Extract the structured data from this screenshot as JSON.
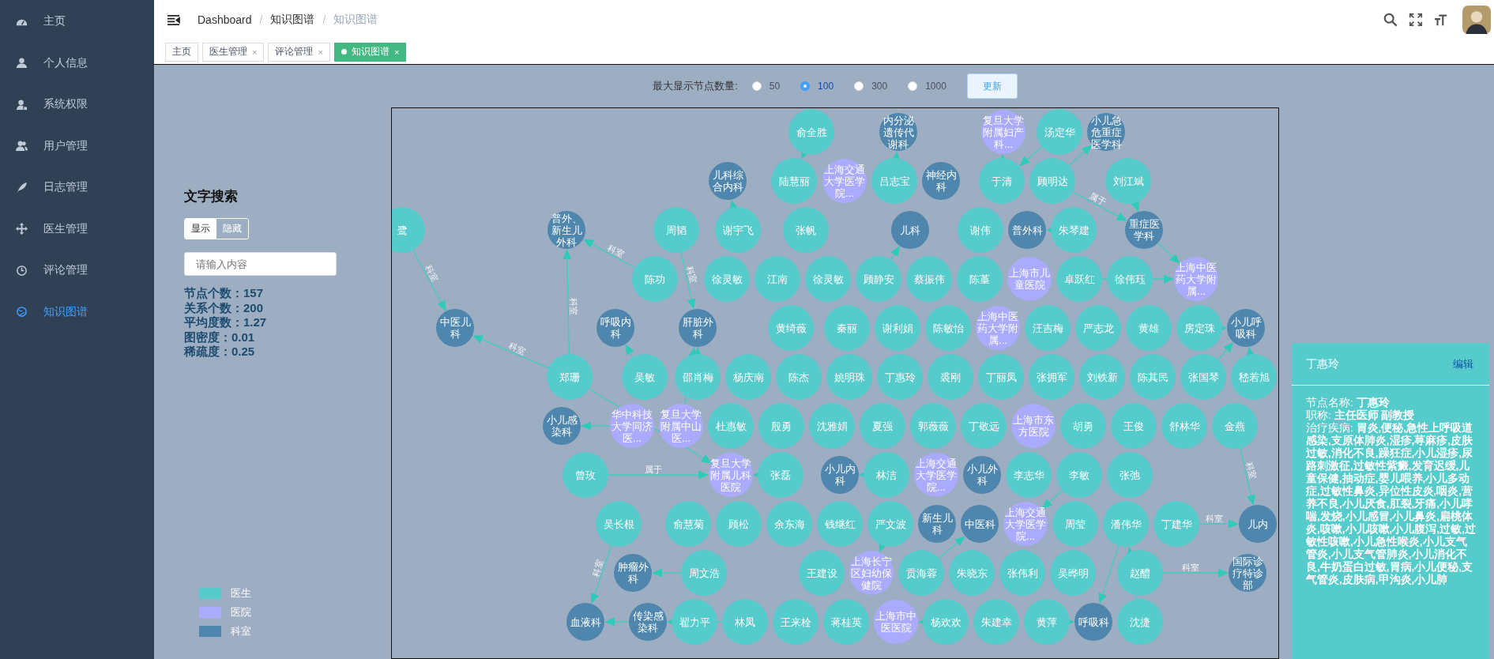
{
  "sidebar": {
    "items": [
      {
        "label": "主页",
        "selected": false
      },
      {
        "label": "个人信息",
        "selected": false
      },
      {
        "label": "系统权限",
        "selected": false
      },
      {
        "label": "用户管理",
        "selected": false
      },
      {
        "label": "日志管理",
        "selected": false
      },
      {
        "label": "医生管理",
        "selected": false
      },
      {
        "label": "评论管理",
        "selected": false
      },
      {
        "label": "知识图谱",
        "selected": true
      }
    ]
  },
  "header": {
    "breadcrumb": [
      {
        "label": "Dashboard"
      },
      {
        "label": "知识图谱",
        "separator": "/"
      },
      {
        "label": "知识图谱",
        "separator": "/"
      }
    ]
  },
  "tabs": [
    {
      "label": "主页",
      "selected": false
    },
    {
      "label": "医生管理",
      "close": "×",
      "selected": false
    },
    {
      "label": "评论管理",
      "close": "×",
      "selected": false
    },
    {
      "label": "知识图谱",
      "close": "×",
      "selected": true
    }
  ],
  "controls": {
    "label": "最大显示节点数量:",
    "options": [
      {
        "label": "50",
        "selected": false
      },
      {
        "label": "100",
        "selected": true
      },
      {
        "label": "300",
        "selected": false
      },
      {
        "label": "1000",
        "selected": false
      }
    ],
    "update_button": "更新"
  },
  "search_panel": {
    "title": "文字搜索",
    "toggle": [
      {
        "label": "显示",
        "selected": true
      },
      {
        "label": "隐藏",
        "selected": false
      }
    ],
    "search": {
      "placeholder": "请输入内容"
    },
    "stats": [
      {
        "label": "节点个数：",
        "value": "157"
      },
      {
        "label": "关系个数：",
        "value": "200"
      },
      {
        "label": "平均度数：",
        "value": "1.27"
      },
      {
        "label": "图密度：",
        "value": "0.01"
      },
      {
        "label": "稀疏度：",
        "value": "0.25"
      }
    ],
    "legend": [
      {
        "kind": "doctor",
        "label": "医生",
        "color": "#56cbcb"
      },
      {
        "kind": "hospital",
        "label": "医院",
        "color": "#aaaaff"
      },
      {
        "kind": "department",
        "label": "科室",
        "color": "#4e86ad"
      }
    ]
  },
  "graph": {
    "nodes": [
      {
        "name": "俞全胜",
        "kind": "doctor"
      },
      {
        "name": "内分泌遗传代谢科",
        "kind": "department"
      },
      {
        "name": "复旦大学附属妇产科...",
        "kind": "hospital"
      },
      {
        "name": "汤定华",
        "kind": "doctor"
      },
      {
        "name": "小儿急危重症医学科",
        "kind": "department"
      },
      {
        "name": "儿科综合内科",
        "kind": "department"
      },
      {
        "name": "陆慧丽",
        "kind": "doctor"
      },
      {
        "name": "上海交通大学医学院...",
        "kind": "hospital"
      },
      {
        "name": "吕志宝",
        "kind": "doctor"
      },
      {
        "name": "神经内科",
        "kind": "department"
      },
      {
        "name": "于清",
        "kind": "doctor"
      },
      {
        "name": "顾明达",
        "kind": "doctor"
      },
      {
        "name": "刘江斌",
        "kind": "doctor"
      },
      {
        "name": "鹭",
        "kind": "doctor"
      },
      {
        "name": "普外、新生儿外科",
        "kind": "department"
      },
      {
        "name": "周韬",
        "kind": "doctor"
      },
      {
        "name": "谢宇飞",
        "kind": "doctor"
      },
      {
        "name": "张帆",
        "kind": "doctor"
      },
      {
        "name": "儿科",
        "kind": "department"
      },
      {
        "name": "谢伟",
        "kind": "doctor"
      },
      {
        "name": "普外科",
        "kind": "department"
      },
      {
        "name": "朱琴建",
        "kind": "doctor"
      },
      {
        "name": "重症医学科",
        "kind": "department"
      },
      {
        "name": "陈功",
        "kind": "doctor"
      },
      {
        "name": "徐灵敏",
        "kind": "doctor"
      },
      {
        "name": "江南",
        "kind": "doctor"
      },
      {
        "name": "徐灵敏",
        "kind": "doctor"
      },
      {
        "name": "顾静安",
        "kind": "doctor"
      },
      {
        "name": "蔡振伟",
        "kind": "doctor"
      },
      {
        "name": "陈堇",
        "kind": "doctor"
      },
      {
        "name": "上海市儿童医院",
        "kind": "hospital"
      },
      {
        "name": "卓跃红",
        "kind": "doctor"
      },
      {
        "name": "徐伟珏",
        "kind": "doctor"
      },
      {
        "name": "上海中医药大学附属...",
        "kind": "hospital"
      },
      {
        "name": "中医儿科",
        "kind": "department"
      },
      {
        "name": "呼吸内科",
        "kind": "department"
      },
      {
        "name": "肝脏外科",
        "kind": "department"
      },
      {
        "name": "黄绮薇",
        "kind": "doctor"
      },
      {
        "name": "秦丽",
        "kind": "doctor"
      },
      {
        "name": "谢利娟",
        "kind": "doctor"
      },
      {
        "name": "陈敏怡",
        "kind": "doctor"
      },
      {
        "name": "上海中医药大学附属...",
        "kind": "hospital"
      },
      {
        "name": "汪吉梅",
        "kind": "doctor"
      },
      {
        "name": "严志龙",
        "kind": "doctor"
      },
      {
        "name": "黄雄",
        "kind": "doctor"
      },
      {
        "name": "房定珠",
        "kind": "doctor"
      },
      {
        "name": "小儿呼吸科",
        "kind": "department"
      },
      {
        "name": "郑珊",
        "kind": "doctor"
      },
      {
        "name": "吴敏",
        "kind": "doctor"
      },
      {
        "name": "邵肖梅",
        "kind": "doctor"
      },
      {
        "name": "杨庆南",
        "kind": "doctor"
      },
      {
        "name": "陈杰",
        "kind": "doctor"
      },
      {
        "name": "姚明珠",
        "kind": "doctor"
      },
      {
        "name": "丁惠玲",
        "kind": "doctor"
      },
      {
        "name": "裘刚",
        "kind": "doctor"
      },
      {
        "name": "丁丽凤",
        "kind": "doctor"
      },
      {
        "name": "张拥军",
        "kind": "doctor"
      },
      {
        "name": "刘铁新",
        "kind": "doctor"
      },
      {
        "name": "陈其民",
        "kind": "doctor"
      },
      {
        "name": "张国琴",
        "kind": "doctor"
      },
      {
        "name": "嵇若旭",
        "kind": "doctor"
      },
      {
        "name": "小儿感染科",
        "kind": "department"
      },
      {
        "name": "华中科技大学同济医...",
        "kind": "hospital"
      },
      {
        "name": "复旦大学附属中山医...",
        "kind": "hospital"
      },
      {
        "name": "杜惠敏",
        "kind": "doctor"
      },
      {
        "name": "殷勇",
        "kind": "doctor"
      },
      {
        "name": "沈雅娟",
        "kind": "doctor"
      },
      {
        "name": "夏强",
        "kind": "doctor"
      },
      {
        "name": "郭薇薇",
        "kind": "doctor"
      },
      {
        "name": "丁敬远",
        "kind": "doctor"
      },
      {
        "name": "上海市东方医院",
        "kind": "hospital"
      },
      {
        "name": "胡勇",
        "kind": "doctor"
      },
      {
        "name": "王俊",
        "kind": "doctor"
      },
      {
        "name": "舒林华",
        "kind": "doctor"
      },
      {
        "name": "金燕",
        "kind": "doctor"
      },
      {
        "name": "曾玫",
        "kind": "doctor"
      },
      {
        "name": "复旦大学附属儿科医院",
        "kind": "hospital"
      },
      {
        "name": "张磊",
        "kind": "doctor"
      },
      {
        "name": "小儿内科",
        "kind": "department"
      },
      {
        "name": "林洁",
        "kind": "doctor"
      },
      {
        "name": "上海交通大学医学院...",
        "kind": "hospital"
      },
      {
        "name": "小儿外科",
        "kind": "department"
      },
      {
        "name": "李志华",
        "kind": "doctor"
      },
      {
        "name": "李敏",
        "kind": "doctor"
      },
      {
        "name": "张弛",
        "kind": "doctor"
      },
      {
        "name": "吴长根",
        "kind": "doctor"
      },
      {
        "name": "俞慧菊",
        "kind": "doctor"
      },
      {
        "name": "顾松",
        "kind": "doctor"
      },
      {
        "name": "余东海",
        "kind": "doctor"
      },
      {
        "name": "钱继红",
        "kind": "doctor"
      },
      {
        "name": "严文波",
        "kind": "doctor"
      },
      {
        "name": "新生儿科",
        "kind": "department"
      },
      {
        "name": "中医科",
        "kind": "department"
      },
      {
        "name": "上海交通大学医学院...",
        "kind": "hospital"
      },
      {
        "name": "周莹",
        "kind": "doctor"
      },
      {
        "name": "潘伟华",
        "kind": "doctor"
      },
      {
        "name": "丁建华",
        "kind": "doctor"
      },
      {
        "name": "儿内",
        "kind": "department"
      },
      {
        "name": "肿瘤外科",
        "kind": "department"
      },
      {
        "name": "周文浩",
        "kind": "doctor"
      },
      {
        "name": "王建设",
        "kind": "doctor"
      },
      {
        "name": "上海长宁区妇幼保健院",
        "kind": "hospital"
      },
      {
        "name": "贡海蓉",
        "kind": "doctor"
      },
      {
        "name": "朱晓东",
        "kind": "doctor"
      },
      {
        "name": "张伟利",
        "kind": "doctor"
      },
      {
        "name": "吴晔明",
        "kind": "doctor"
      },
      {
        "name": "赵醴",
        "kind": "doctor"
      },
      {
        "name": "国际诊疗特诊部",
        "kind": "department"
      },
      {
        "name": "血液科",
        "kind": "department"
      },
      {
        "name": "传染感染科",
        "kind": "department"
      },
      {
        "name": "翟力平",
        "kind": "doctor"
      },
      {
        "name": "林凤",
        "kind": "doctor"
      },
      {
        "name": "王来栓",
        "kind": "doctor"
      },
      {
        "name": "蒋桂英",
        "kind": "doctor"
      },
      {
        "name": "上海市中医医院",
        "kind": "hospital"
      },
      {
        "name": "杨欢欢",
        "kind": "doctor"
      },
      {
        "name": "朱建幸",
        "kind": "doctor"
      },
      {
        "name": "黄萍",
        "kind": "doctor"
      },
      {
        "name": "呼吸科",
        "kind": "department"
      },
      {
        "name": "沈捷",
        "kind": "doctor"
      }
    ],
    "edges": [
      {
        "label": "科室"
      },
      {
        "label": "科室"
      },
      {
        "label": "科室"
      },
      {
        "label": "科室"
      },
      {
        "label": "科室"
      },
      {
        "label": "科室"
      },
      {
        "label": "科室"
      },
      {
        "label": "科室"
      },
      {
        "label": "科室"
      },
      {
        "label": "属于"
      },
      {
        "label": "属于"
      }
    ]
  },
  "detail_panel": {
    "title": "丁惠玲",
    "edit_link": "编辑",
    "fields": [
      {
        "label": "节点名称: ",
        "value": "丁惠玲"
      },
      {
        "label": "职称: ",
        "value": "主任医师  副教授"
      },
      {
        "label": "治疗疾病: ",
        "value": "胃炎,便秘,急性上呼吸道感染,支原体肺炎,湿疹,荨麻疹,皮肤过敏,消化不良,躁狂症,小儿湿疹,尿路刺激征,过敏性紫癜,发育迟缓,儿童保健,抽动症,婴儿喂养,小儿多动症,过敏性鼻炎,异位性皮炎,咽炎,营养不良,小儿厌食,肛裂,牙痛,小儿哮喘,发烧,小儿感冒,小儿鼻炎,扁桃体炎,咳嗽,小儿咳嗽,小儿腹泻,过敏,过敏性咳嗽,小儿急性喉炎,小儿支气管炎,小儿支气管肺炎,小儿消化不良,牛奶蛋白过敏,胃病,小儿便秘,支气管炎,皮肤病,甲沟炎,小儿肺"
      }
    ]
  }
}
